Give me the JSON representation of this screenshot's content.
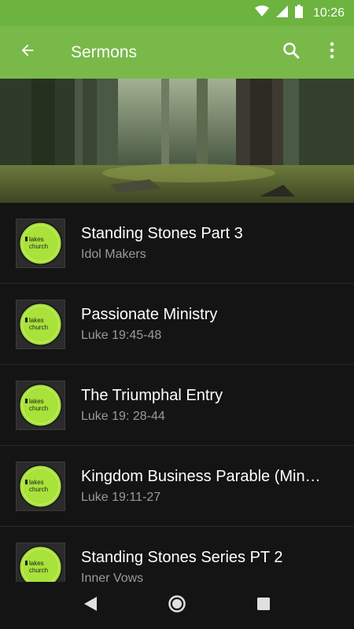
{
  "status": {
    "time": "10:26"
  },
  "appbar": {
    "title": "Sermons"
  },
  "colors": {
    "status_bar": "#6db33f",
    "app_bar": "#79b94a",
    "background": "#141414",
    "logo_green": "#a8e23a"
  },
  "icons": [
    "back-arrow-icon",
    "search-icon",
    "more-vert-icon",
    "wifi-icon",
    "signal-icon",
    "battery-icon",
    "nav-back-icon",
    "nav-home-icon",
    "nav-recents-icon"
  ],
  "sermons": [
    {
      "title": "Standing Stones Part 3",
      "subtitle": "Idol Makers"
    },
    {
      "title": "Passionate Ministry",
      "subtitle": "Luke 19:45-48"
    },
    {
      "title": "The Triumphal Entry",
      "subtitle": "Luke 19: 28-44"
    },
    {
      "title": "Kingdom Business Parable (Min…",
      "subtitle": "Luke 19:11-27"
    },
    {
      "title": "Standing Stones Series PT 2",
      "subtitle": "Inner Vows"
    }
  ],
  "logo": {
    "line1": "lakes",
    "line2": "church"
  }
}
